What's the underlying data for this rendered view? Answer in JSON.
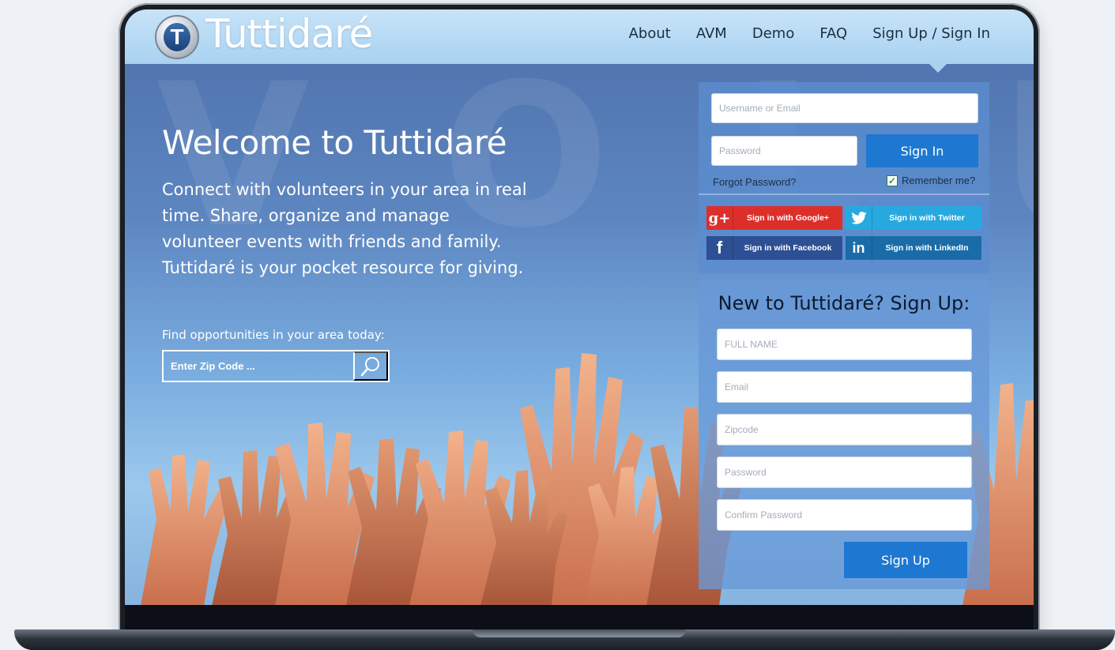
{
  "brand": {
    "name": "Tuttidaré",
    "logo_letter": "T"
  },
  "nav": {
    "items": [
      "About",
      "AVM",
      "Demo",
      "FAQ",
      "Sign Up / Sign In"
    ]
  },
  "hero": {
    "title": "Welcome to Tuttidaré",
    "body": "Connect with volunteers in your area in real time. Share, organize and manage volunteer events with friends and family. Tuttidaré is your pocket resource for giving.",
    "find_label": "Find opportunities in your area today:",
    "zip_placeholder": "Enter Zip Code ..."
  },
  "login": {
    "username_placeholder": "Username or Email",
    "password_placeholder": "Password",
    "sign_in_label": "Sign In",
    "forgot_label": "Forgot Password?",
    "remember_label": "Remember me?",
    "remember_checked": true,
    "social": [
      {
        "label": "Sign in with Google+",
        "icon": "google-plus-icon",
        "glyph": "g+",
        "color": "#dd2f2a"
      },
      {
        "label": "Sign in with Twitter",
        "icon": "twitter-icon",
        "glyph": "🐦",
        "color": "#27a9e0"
      },
      {
        "label": "Sign in with Facebook",
        "icon": "facebook-icon",
        "glyph": "f",
        "color": "#2d4f93"
      },
      {
        "label": "Sign in with LinkedIn",
        "icon": "linkedin-icon",
        "glyph": "in",
        "color": "#1a6ca9"
      }
    ]
  },
  "signup": {
    "title": "New to Tuttidaré? Sign Up:",
    "fullname_placeholder": "FULL NAME",
    "email_placeholder": "Email",
    "zipcode_placeholder": "Zipcode",
    "password_placeholder": "Password",
    "confirm_placeholder": "Confirm Password",
    "submit_label": "Sign Up"
  },
  "colors": {
    "header": "#b3d9f4",
    "accent": "#1e78d2",
    "panel": "#5b8cce"
  }
}
